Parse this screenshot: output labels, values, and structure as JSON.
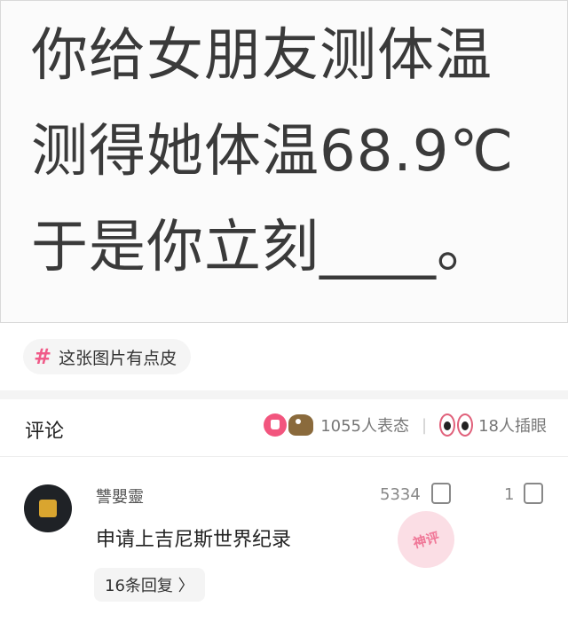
{
  "post": {
    "lines": [
      "你给女朋友测体温",
      "测得她体温68.9℃",
      "于是你立刻____。"
    ]
  },
  "tag": {
    "icon": "hash-icon",
    "label": "这张图片有点皮",
    "accent": "#f05a88"
  },
  "comments_section": {
    "title": "评论",
    "reactions_text": "1055人表态",
    "eyes_text": "18人插眼"
  },
  "comment": {
    "username": "讐嬰靈",
    "likes": "5334",
    "dislikes": "1",
    "text": "申请上吉尼斯世界纪录",
    "stamp": "神评",
    "replies": "16条回复 〉"
  }
}
